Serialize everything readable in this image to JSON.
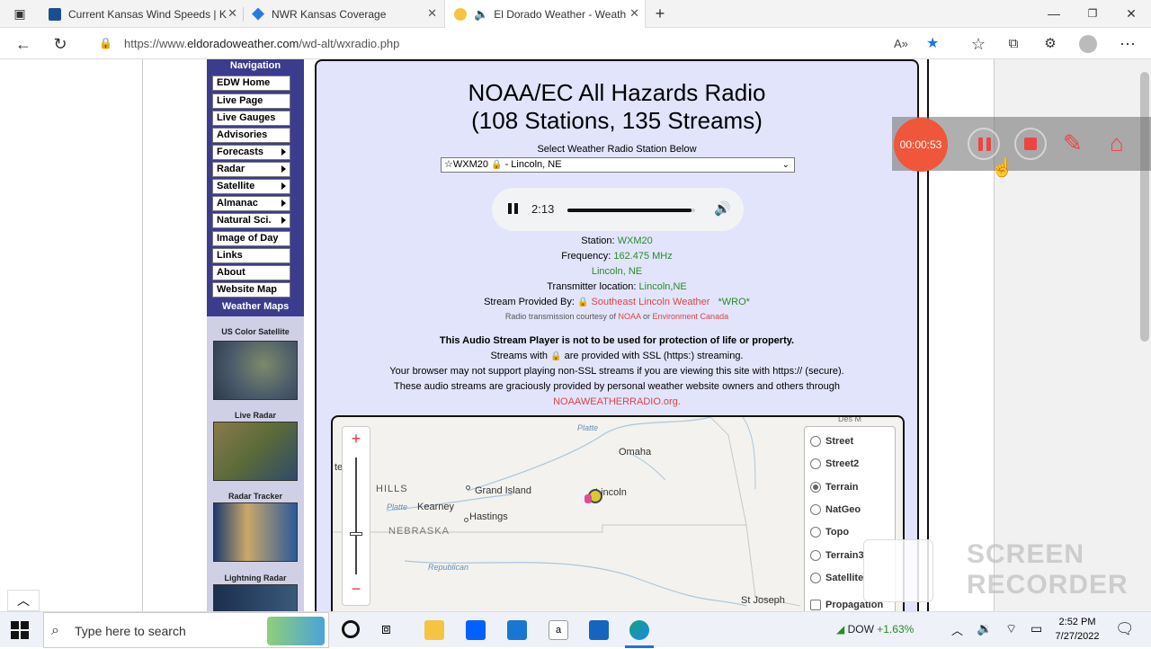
{
  "browser": {
    "tabs": [
      {
        "title": "Current Kansas Wind Speeds | K",
        "active": false
      },
      {
        "title": "NWR Kansas Coverage",
        "active": false
      },
      {
        "title": "El Dorado Weather - Weath",
        "active": true
      }
    ],
    "url_prefix": "https://www.",
    "url_host": "eldoradoweather.com",
    "url_path": "/wd-alt/wxradio.php"
  },
  "sidebar": {
    "nav_heading": "Navigation",
    "items": [
      {
        "label": "EDW Home",
        "submenu": false
      },
      {
        "label": "Live Page",
        "submenu": false
      },
      {
        "label": "Live Gauges",
        "submenu": false
      },
      {
        "label": "Advisories",
        "submenu": false
      },
      {
        "label": "Forecasts",
        "submenu": true
      },
      {
        "label": "Radar",
        "submenu": true
      },
      {
        "label": "Satellite",
        "submenu": true
      },
      {
        "label": "Almanac",
        "submenu": true
      },
      {
        "label": "Natural Sci.",
        "submenu": true
      },
      {
        "label": "Image of Day",
        "submenu": false
      },
      {
        "label": "Links",
        "submenu": false
      },
      {
        "label": "About",
        "submenu": false
      },
      {
        "label": "Website Map",
        "submenu": false
      }
    ],
    "maps_heading": "Weather Maps",
    "maps": [
      "US Color Satellite",
      "Live Radar",
      "Radar Tracker",
      "Lightning Radar"
    ]
  },
  "main": {
    "title_line1": "NOAA/EC All Hazards Radio",
    "title_line2": "(108 Stations, 135 Streams)",
    "select_label": "Select Weather Radio Station Below",
    "selected_station_prefix": "☆WXM20",
    "selected_station_suffix": "- Lincoln, NE",
    "player_time": "2:13",
    "player_progress": 0.97,
    "station_label": "Station:",
    "station_value": "WXM20",
    "frequency_label": "Frequency:",
    "frequency_value": "162.475 MHz",
    "area_value": "Lincoln, NE",
    "transmitter_label": "Transmitter location:",
    "transmitter_value": "Lincoln,NE",
    "provided_label": "Stream Provided By:",
    "provider": "Southeast Lincoln Weather",
    "provider_tag": "*WRO*",
    "courtesy_prefix": "Radio transmission courtesy of",
    "courtesy_noaa": "NOAA",
    "courtesy_or": "or",
    "courtesy_ec": "Environment Canada",
    "notice_bold": "This Audio Stream Player is not to be used for protection of life or property.",
    "notice_ssl_a": "Streams with",
    "notice_ssl_b": "are provided with SSL (https:) streaming.",
    "notice_browser": "Your browser may not support playing non-SSL streams if you are viewing this site with https:// (secure).",
    "notice_gracious": "These audio streams are graciously provided by personal weather website owners and others through",
    "noaa_link": "NOAAWEATHERRADIO.org",
    "noaa_link_dot": "."
  },
  "map": {
    "places": [
      "Omaha",
      "Lincoln",
      "Grand Island",
      "Kearney",
      "Hastings",
      "St Joseph",
      "HILLS",
      "te",
      "Des M"
    ],
    "state": "NEBRASKA",
    "rivers": [
      "Platte",
      "Platte",
      "Republican"
    ],
    "zoom_in": "+",
    "zoom_out": "−",
    "layers": [
      "Street",
      "Street2",
      "Terrain",
      "NatGeo",
      "Topo",
      "Terrain3",
      "Satellite",
      "Propagation"
    ],
    "selected_layer": "Terrain"
  },
  "recorder": {
    "timer": "00:00:53",
    "watermark_line1": "SCREEN",
    "watermark_line2": "RECORDER"
  },
  "taskbar": {
    "search_placeholder": "Type here to search",
    "stock_name": "DOW",
    "stock_change": "+1.63%",
    "time": "2:52 PM",
    "date": "7/27/2022"
  },
  "colors": {
    "sidebar": "#3b3c8e",
    "main_bg": "#e2e4fb",
    "link_green": "#2a8a2a",
    "link_red": "#d44444",
    "record_red": "#f0563a"
  }
}
